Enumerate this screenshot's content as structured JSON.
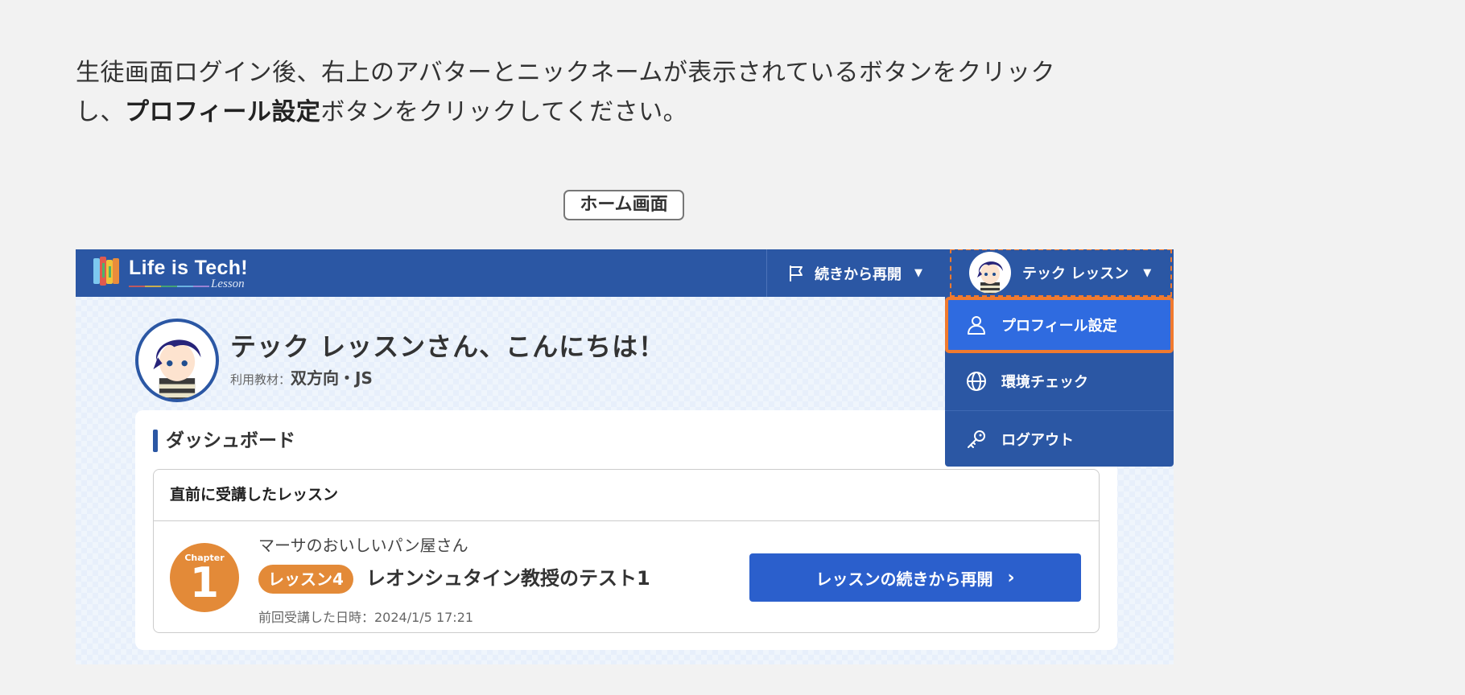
{
  "instruction": {
    "line1": "生徒画面ログイン後、右上のアバターとニックネームが表示されているボタンをクリック",
    "line2_prefix": "し、",
    "line2_bold": "プロフィール設定",
    "line2_suffix": "ボタンをクリックしてください。"
  },
  "screen_label": "ホーム画面",
  "header": {
    "logo_text": "Life is Tech!",
    "logo_sub": "Lesson",
    "resume_menu_label": "続きから再開",
    "user_menu_label": "テック レッスン"
  },
  "dropdown": {
    "items": [
      {
        "label": "プロフィール設定",
        "icon": "user-icon"
      },
      {
        "label": "環境チェック",
        "icon": "globe-icon"
      },
      {
        "label": "ログアウト",
        "icon": "key-icon"
      }
    ]
  },
  "profile": {
    "greeting": "テック レッスンさん、こんにちは！",
    "material_label": "利用教材：",
    "material_value": "双方向・JS"
  },
  "dashboard": {
    "title": "ダッシュボード",
    "recent_header": "直前に受講したレッスン",
    "chapter_label": "Chapter",
    "chapter_number": "1",
    "course_name": "マーサのおいしいパン屋さん",
    "lesson_badge": "レッスン4",
    "lesson_title": "レオンシュタイン教授のテスト1",
    "last_date": "前回受講した日時：2024/1/5 17:21",
    "resume_button": "レッスンの続きから再開"
  },
  "colors": {
    "primary": "#2b57a4",
    "highlight_border": "#f07a2f",
    "accent_orange": "#e38a38",
    "button_blue": "#2b5fcc"
  }
}
